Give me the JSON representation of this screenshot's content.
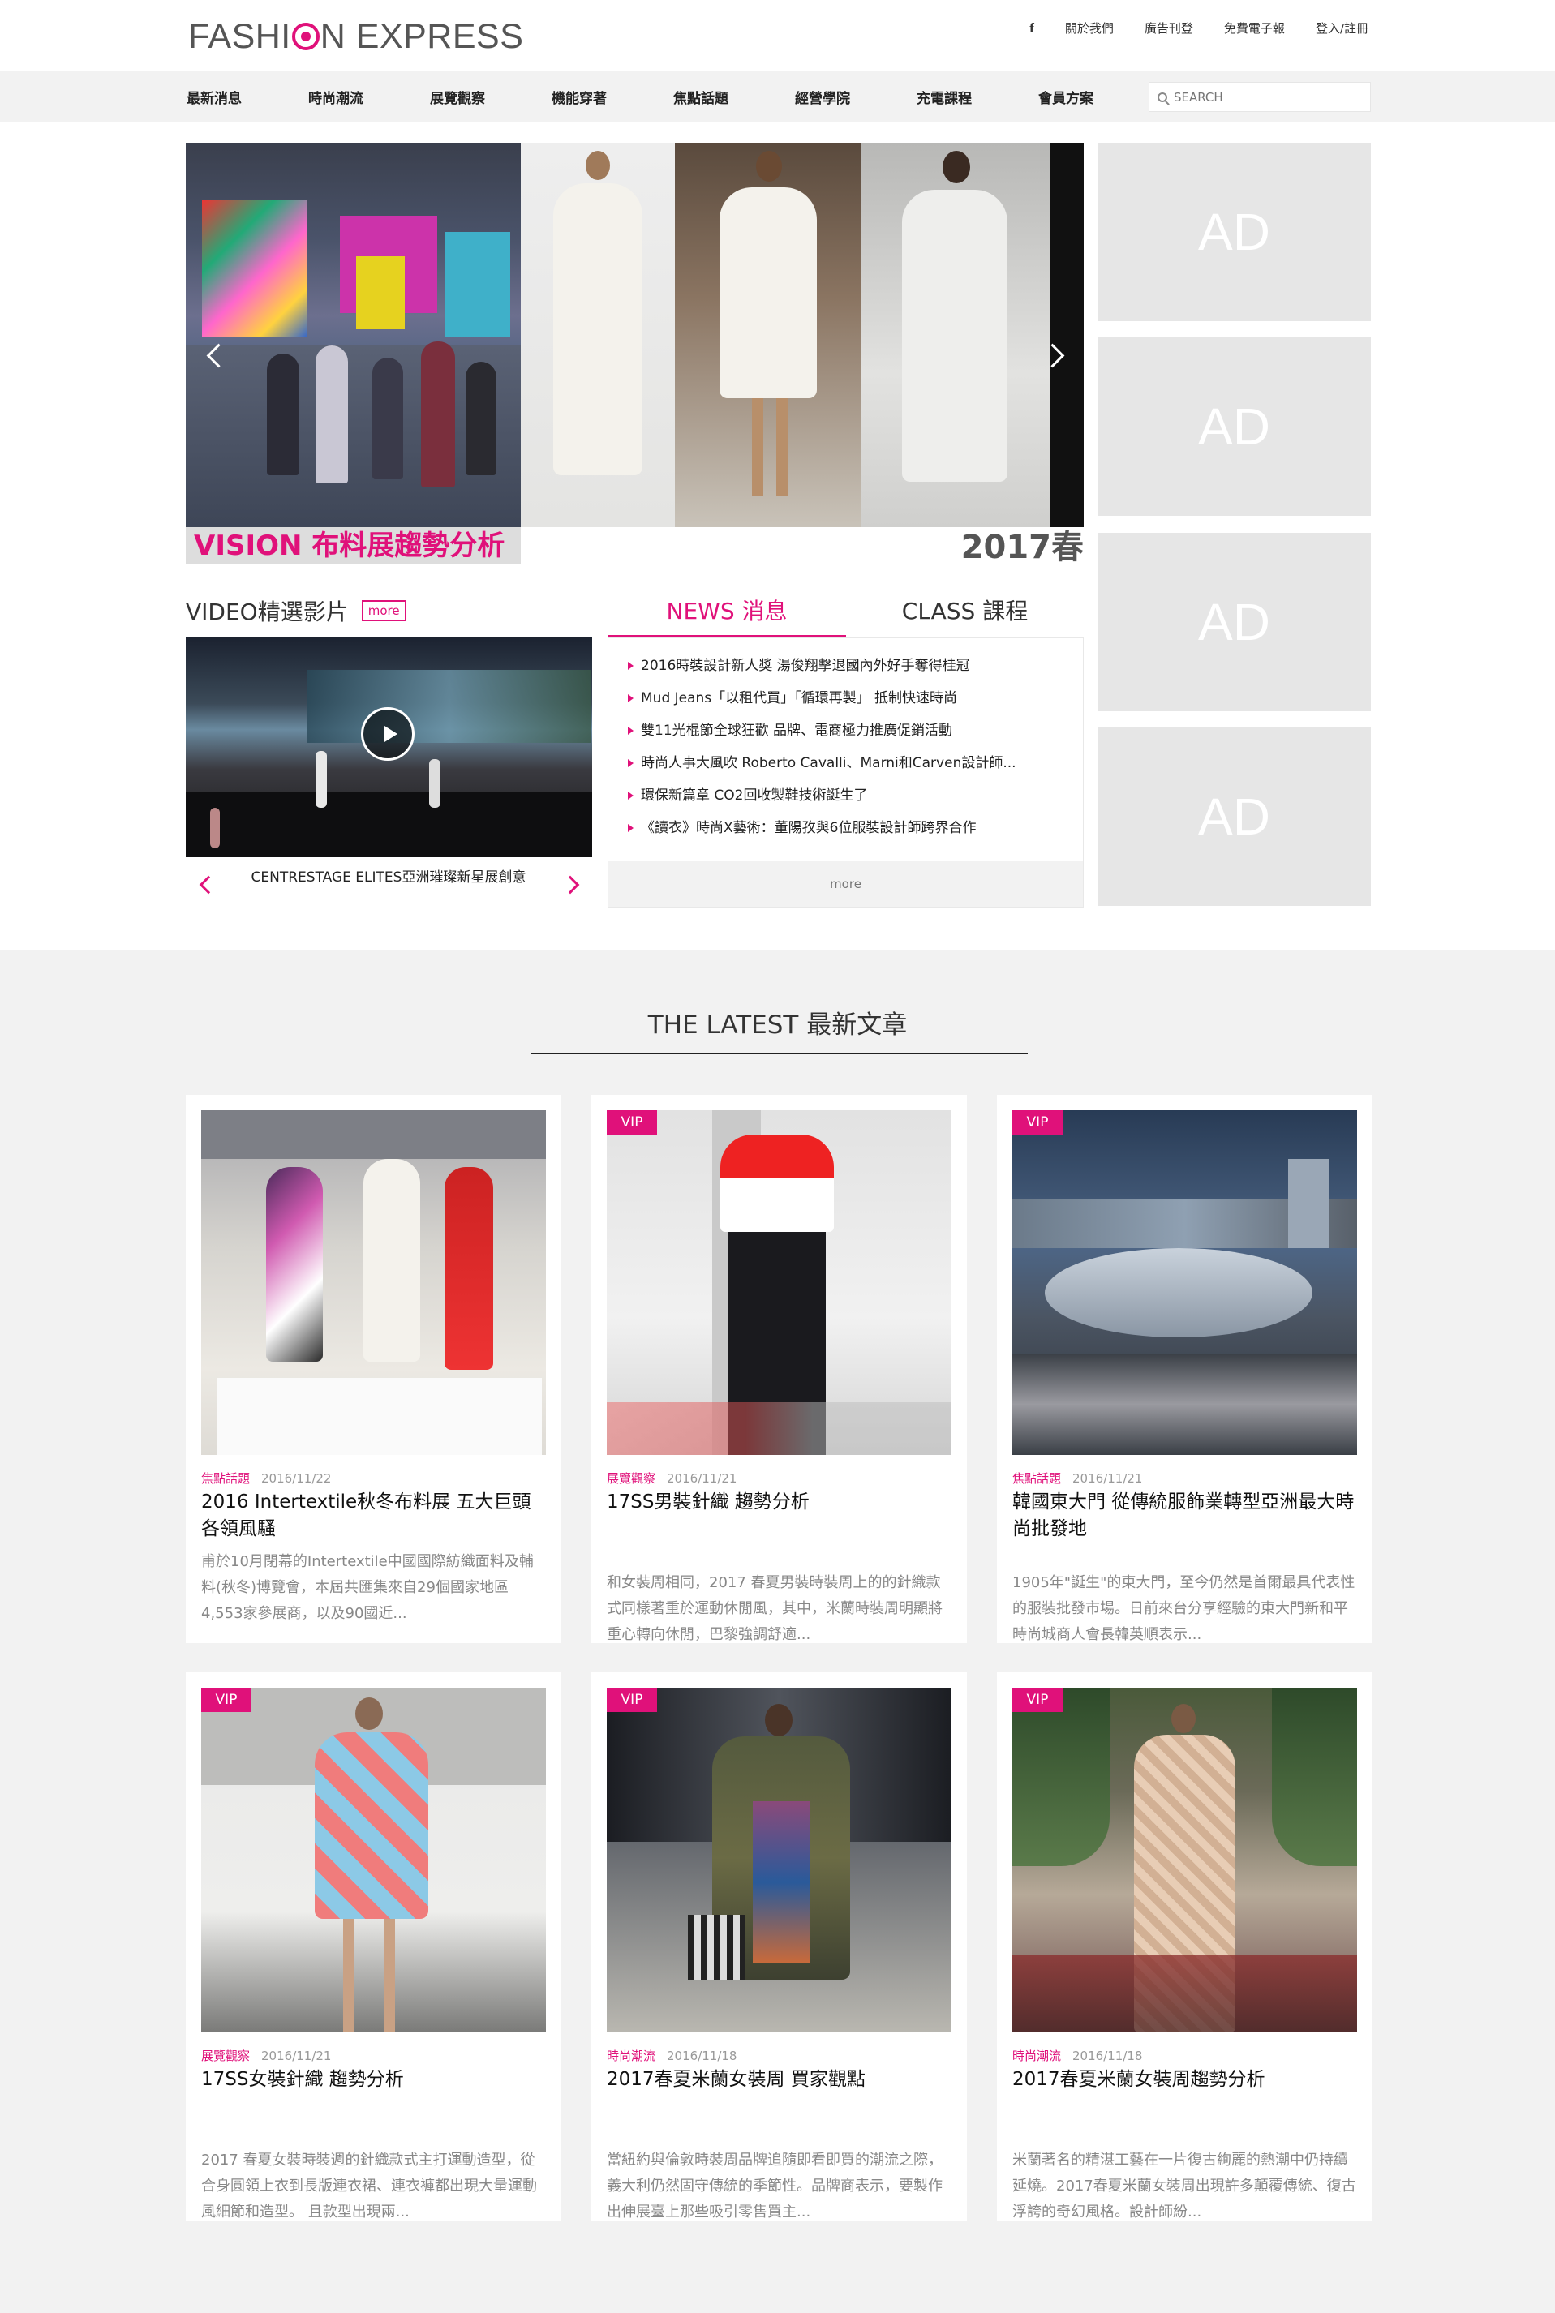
{
  "header": {
    "logo_part1": "FASHI",
    "logo_part2": "N EXPRESS",
    "links": [
      "f",
      "關於我們",
      "廣告刊登",
      "免費電子報",
      "登入/註冊"
    ]
  },
  "nav": {
    "items": [
      "最新消息",
      "時尚潮流",
      "展覽觀察",
      "機能穿著",
      "焦點話題",
      "經營學院",
      "充電課程",
      "會員方案"
    ],
    "search_placeholder": "SEARCH"
  },
  "banner": {
    "caption_left": "VISION 布料展趨勢分析",
    "caption_right": "2017春"
  },
  "ads": [
    "AD",
    "AD",
    "AD",
    "AD"
  ],
  "video": {
    "title": "VIDEO精選影片",
    "more": "more",
    "caption": "CENTRESTAGE ELITES亞洲璀璨新星展創意"
  },
  "tabs": {
    "news": "NEWS 消息",
    "class": "CLASS 課程"
  },
  "news": {
    "items": [
      "2016時裝設計新人獎 湯俊翔擊退國內外好手奪得桂冠",
      "Mud Jeans「以租代買」「循環再製」 抵制快速時尚",
      "雙11光棍節全球狂歡 品牌、電商極力推廣促銷活動",
      "時尚人事大風吹 Roberto Cavalli、Marni和Carven設計師...",
      "環保新篇章 CO2回收製鞋技術誕生了",
      "《讀衣》時尚X藝術：董陽孜與6位服裝設計師跨界合作"
    ],
    "more": "more"
  },
  "latest": {
    "title": "THE LATEST 最新文章",
    "vip_label": "VIP",
    "cards": [
      {
        "category": "焦點話題",
        "date": "2016/11/22",
        "title": "2016 Intertextile秋冬布料展 五大巨頭各領風騷",
        "excerpt": "甫於10月閉幕的Intertextile中國國際紡織面料及輔料(秋冬)博覽會，本屆共匯集來自29個國家地區4,553家參展商，以及90國近...",
        "vip": false
      },
      {
        "category": "展覽觀察",
        "date": "2016/11/21",
        "title": "17SS男裝針織 趨勢分析",
        "excerpt": "和女裝周相同，2017 春夏男裝時裝周上的的針織款式同樣著重於運動休閒風，其中，米蘭時裝周明顯將重心轉向休閒，巴黎強調舒適...",
        "vip": true
      },
      {
        "category": "焦點話題",
        "date": "2016/11/21",
        "title": "韓國東大門 從傳統服飾業轉型亞洲最大時尚批發地",
        "excerpt": "1905年\"誕生\"的東大門，至今仍然是首爾最具代表性的服裝批發市場。日前來台分享經驗的東大門新和平時尚城商人會長韓英順表示...",
        "vip": true
      },
      {
        "category": "展覽觀察",
        "date": "2016/11/21",
        "title": "17SS女裝針織 趨勢分析",
        "excerpt": "2017 春夏女裝時裝週的針織款式主打運動造型，從合身圓領上衣到長版連衣裙、連衣褲都出現大量運動風細節和造型。 且款型出現兩...",
        "vip": true
      },
      {
        "category": "時尚潮流",
        "date": "2016/11/18",
        "title": "2017春夏米蘭女裝周 買家觀點",
        "excerpt": "當紐約與倫敦時裝周品牌追隨即看即買的潮流之際，義大利仍然固守傳統的季節性。品牌商表示，要製作出伸展臺上那些吸引零售買主...",
        "vip": true
      },
      {
        "category": "時尚潮流",
        "date": "2016/11/18",
        "title": "2017春夏米蘭女裝周趨勢分析",
        "excerpt": "米蘭著名的精湛工藝在一片復古絢麗的熱潮中仍持續延燒。2017春夏米蘭女裝周出現許多顛覆傳統、復古浮誇的奇幻風格。設計師紛...",
        "vip": true
      }
    ]
  },
  "colors": {
    "accent": "#e0117a",
    "ad_gray": "#e6e6e6",
    "section_gray": "#f2f2f2"
  }
}
